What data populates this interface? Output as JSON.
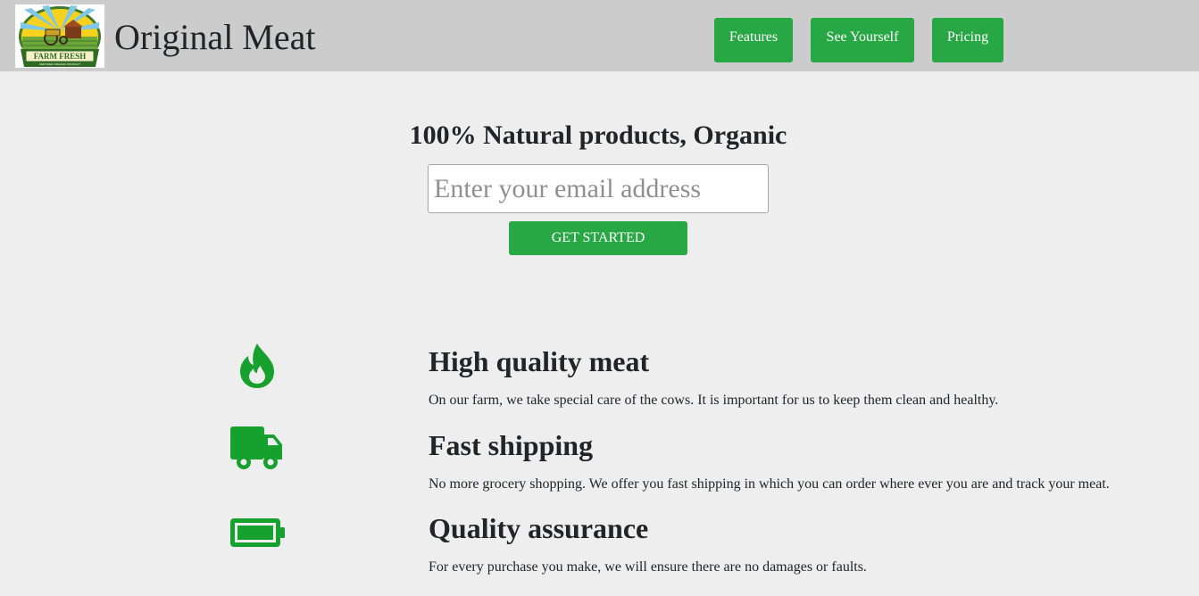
{
  "header": {
    "logo": {
      "text": "FARM FRESH",
      "subtext": "CERTIFIED ORGANIC PRODUCT"
    },
    "brand": "Original Meat",
    "nav": [
      {
        "label": "Features"
      },
      {
        "label": "See Yourself"
      },
      {
        "label": "Pricing"
      }
    ]
  },
  "hero": {
    "title": "100% Natural products, Organic",
    "email_placeholder": "Enter your email address",
    "cta_label": "GET STARTED"
  },
  "features": [
    {
      "icon": "fire-icon",
      "title": "High quality meat",
      "description": "On our farm, we take special care of the cows. It is important for us to keep them clean and healthy."
    },
    {
      "icon": "truck-icon",
      "title": "Fast shipping",
      "description": "No more grocery shopping. We offer you fast shipping in which you can order where ever you are and track your meat."
    },
    {
      "icon": "battery-full-icon",
      "title": "Quality assurance",
      "description": "For every purchase you make, we will ensure there are no damages or faults."
    }
  ],
  "colors": {
    "header_bg": "#cccccc",
    "page_bg": "#eeeeee",
    "accent_green": "#28a745",
    "icon_green": "#16a02e"
  }
}
